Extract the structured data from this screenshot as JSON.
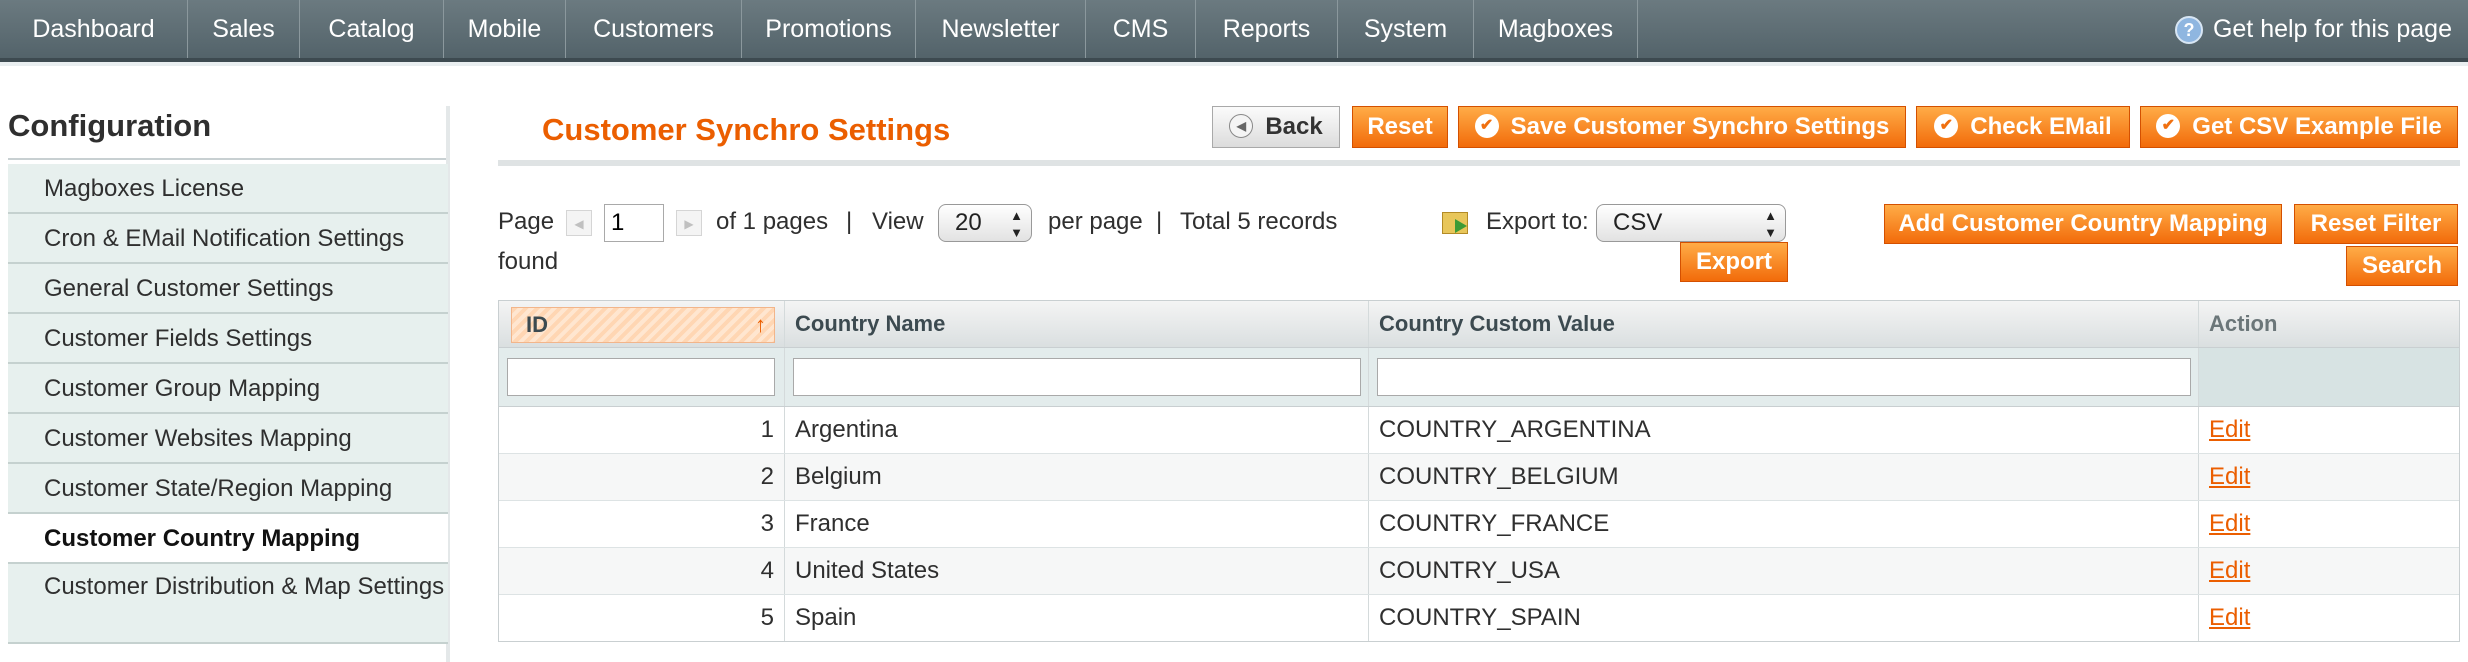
{
  "nav": {
    "items": [
      "Dashboard",
      "Sales",
      "Catalog",
      "Mobile",
      "Customers",
      "Promotions",
      "Newsletter",
      "CMS",
      "Reports",
      "System",
      "Magboxes"
    ],
    "help": "Get help for this page"
  },
  "sidebar": {
    "title": "Configuration",
    "items": [
      {
        "label": "Magboxes License"
      },
      {
        "label": "Cron & EMail Notification Settings"
      },
      {
        "label": "General Customer Settings"
      },
      {
        "label": "Customer Fields Settings"
      },
      {
        "label": "Customer Group Mapping"
      },
      {
        "label": "Customer Websites Mapping"
      },
      {
        "label": "Customer State/Region Mapping"
      },
      {
        "label": "Customer Country Mapping"
      },
      {
        "label": "Customer Distribution & Map Settings"
      }
    ],
    "active_index": 7
  },
  "header": {
    "title": "Customer Synchro Settings",
    "back": "Back",
    "reset": "Reset",
    "save": "Save Customer Synchro Settings",
    "check_email": "Check EMail",
    "csv_example": "Get CSV Example File"
  },
  "pager": {
    "page_label": "Page",
    "page_value": "1",
    "of_pages": "of 1 pages",
    "sep": "|",
    "view_label": "View",
    "per_page_value": "20",
    "per_page_label": "per page",
    "total": "Total 5 records",
    "found": "found",
    "export_label": "Export to:",
    "export_format": "CSV",
    "export_button": "Export"
  },
  "actions": {
    "add_mapping": "Add Customer Country Mapping",
    "reset_filter": "Reset Filter",
    "search": "Search"
  },
  "grid": {
    "columns": [
      "ID",
      "Country Name",
      "Country Custom Value",
      "Action"
    ],
    "rows": [
      {
        "id": "1",
        "name": "Argentina",
        "value": "COUNTRY_ARGENTINA",
        "action": "Edit"
      },
      {
        "id": "2",
        "name": "Belgium",
        "value": "COUNTRY_BELGIUM",
        "action": "Edit"
      },
      {
        "id": "3",
        "name": "France",
        "value": "COUNTRY_FRANCE",
        "action": "Edit"
      },
      {
        "id": "4",
        "name": "United States",
        "value": "COUNTRY_USA",
        "action": "Edit"
      },
      {
        "id": "5",
        "name": "Spain",
        "value": "COUNTRY_SPAIN",
        "action": "Edit"
      }
    ]
  },
  "colors": {
    "accent": "#eb5e00",
    "nav_bg": "#5e6d73",
    "sidebar_bg": "#e7f0ee"
  },
  "icons": {
    "help": "help-icon",
    "back": "back-arrow-icon",
    "check": "check-circle-icon",
    "export": "export-file-icon",
    "sort": "sort-up-arrow-icon"
  }
}
